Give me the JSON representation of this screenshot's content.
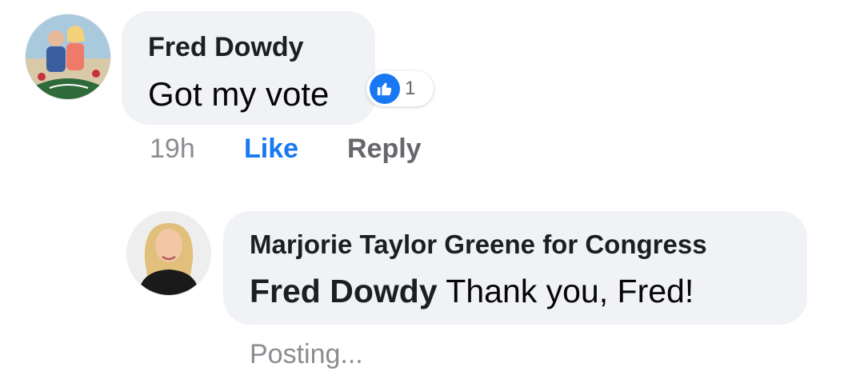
{
  "comment": {
    "author": "Fred Dowdy",
    "text": "Got my vote",
    "reaction_count": "1",
    "time": "19h",
    "like_label": "Like",
    "reply_label": "Reply"
  },
  "reply": {
    "author": "Marjorie Taylor Greene for Congress",
    "mention": "Fred Dowdy",
    "text": " Thank you, Fred!",
    "status": "Posting..."
  },
  "colors": {
    "bubble": "#f0f2f5",
    "link_blue": "#1877f2",
    "muted": "#8a8d91"
  },
  "icons": {
    "reaction": "thumbs-up-icon"
  }
}
